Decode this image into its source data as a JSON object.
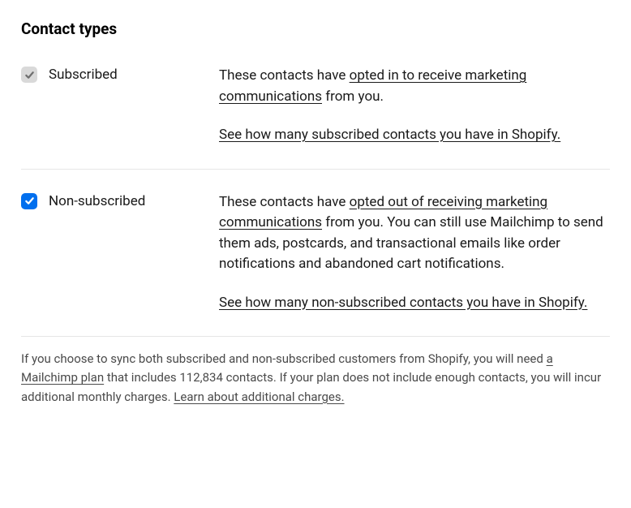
{
  "heading": "Contact types",
  "subscribed": {
    "label": "Subscribed",
    "desc_pre": "These contacts have ",
    "desc_link": "opted in to receive marketing communications",
    "desc_post": " from you.",
    "cta": "See how many subscribed contacts you have in Shopify."
  },
  "nonsubscribed": {
    "label": "Non-subscribed",
    "desc_pre": "These contacts have ",
    "desc_link": "opted out of receiving marketing communications",
    "desc_post": " from you. You can still use Mailchimp to send them ads, postcards, and transactional emails like order notifications and abandoned cart notifications.",
    "cta": "See how many non-subscribed contacts you have in Shopify."
  },
  "footer": {
    "part1": "If you choose to sync both subscribed and non-subscribed customers from Shopify, you will need ",
    "link1": "a Mailchimp plan",
    "part2": " that includes 112,834 contacts. If your plan does not include enough contacts, you will incur additional monthly charges. ",
    "link2": "Learn about additional charges."
  }
}
